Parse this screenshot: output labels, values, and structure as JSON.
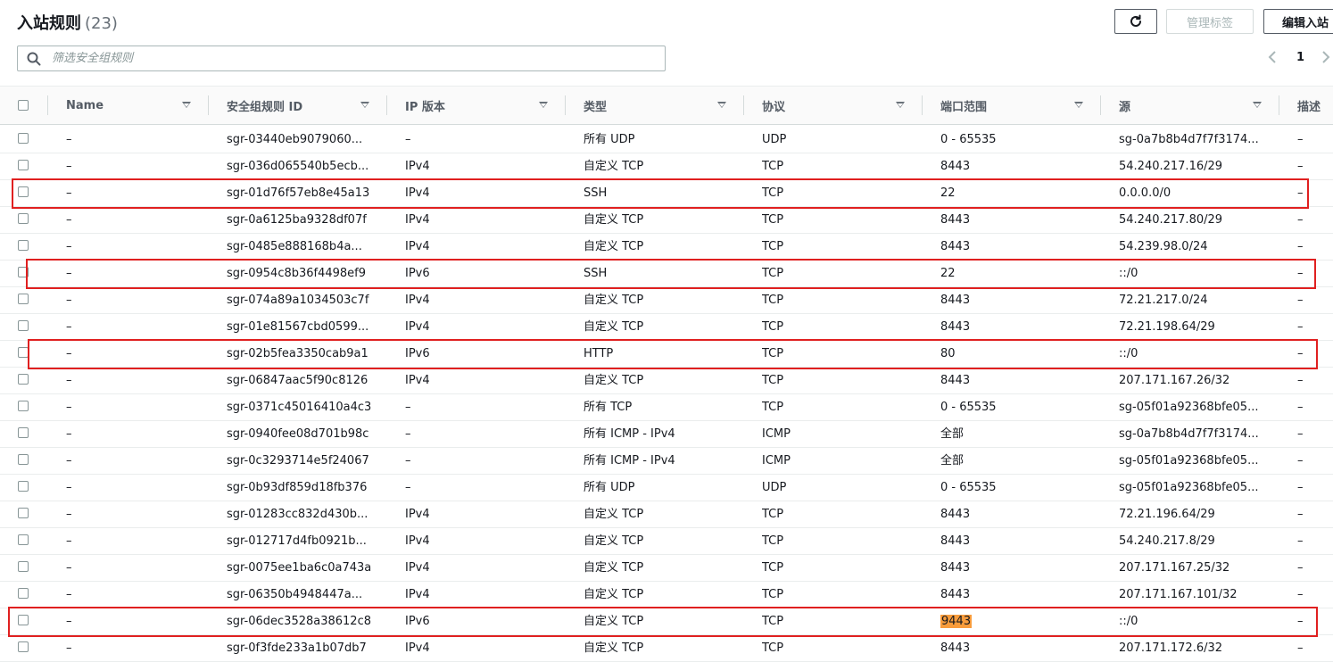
{
  "header": {
    "title": "入站规则",
    "count": "(23)"
  },
  "toolbar": {
    "tags_label": "管理标签",
    "edit_label": "编辑入站"
  },
  "search": {
    "placeholder": "筛选安全组规则"
  },
  "pagination": {
    "prev": "‹",
    "current": "1",
    "next": "›"
  },
  "columns": [
    "Name",
    "安全组规则 ID",
    "IP 版本",
    "类型",
    "协议",
    "端口范围",
    "源",
    "描述"
  ],
  "rows": [
    {
      "name": "–",
      "id": "sgr-03440eb9079060...",
      "ip": "–",
      "type": "所有 UDP",
      "proto": "UDP",
      "port": "0 - 65535",
      "source": "sg-0a7b8b4d7f7f3174...",
      "desc": "–"
    },
    {
      "name": "–",
      "id": "sgr-036d065540b5ecb...",
      "ip": "IPv4",
      "type": "自定义 TCP",
      "proto": "TCP",
      "port": "8443",
      "source": "54.240.217.16/29",
      "desc": "–"
    },
    {
      "name": "–",
      "id": "sgr-01d76f57eb8e45a13",
      "ip": "IPv4",
      "type": "SSH",
      "proto": "TCP",
      "port": "22",
      "source": "0.0.0.0/0",
      "desc": "–"
    },
    {
      "name": "–",
      "id": "sgr-0a6125ba9328df07f",
      "ip": "IPv4",
      "type": "自定义 TCP",
      "proto": "TCP",
      "port": "8443",
      "source": "54.240.217.80/29",
      "desc": "–"
    },
    {
      "name": "–",
      "id": "sgr-0485e888168b4a...",
      "ip": "IPv4",
      "type": "自定义 TCP",
      "proto": "TCP",
      "port": "8443",
      "source": "54.239.98.0/24",
      "desc": "–"
    },
    {
      "name": "–",
      "id": "sgr-0954c8b36f4498ef9",
      "ip": "IPv6",
      "type": "SSH",
      "proto": "TCP",
      "port": "22",
      "source": "::/0",
      "desc": "–"
    },
    {
      "name": "–",
      "id": "sgr-074a89a1034503c7f",
      "ip": "IPv4",
      "type": "自定义 TCP",
      "proto": "TCP",
      "port": "8443",
      "source": "72.21.217.0/24",
      "desc": "–"
    },
    {
      "name": "–",
      "id": "sgr-01e81567cbd0599...",
      "ip": "IPv4",
      "type": "自定义 TCP",
      "proto": "TCP",
      "port": "8443",
      "source": "72.21.198.64/29",
      "desc": "–"
    },
    {
      "name": "–",
      "id": "sgr-02b5fea3350cab9a1",
      "ip": "IPv6",
      "type": "HTTP",
      "proto": "TCP",
      "port": "80",
      "source": "::/0",
      "desc": "–"
    },
    {
      "name": "–",
      "id": "sgr-06847aac5f90c8126",
      "ip": "IPv4",
      "type": "自定义 TCP",
      "proto": "TCP",
      "port": "8443",
      "source": "207.171.167.26/32",
      "desc": "–"
    },
    {
      "name": "–",
      "id": "sgr-0371c45016410a4c3",
      "ip": "–",
      "type": "所有 TCP",
      "proto": "TCP",
      "port": "0 - 65535",
      "source": "sg-05f01a92368bfe05...",
      "desc": "–"
    },
    {
      "name": "–",
      "id": "sgr-0940fee08d701b98c",
      "ip": "–",
      "type": "所有 ICMP - IPv4",
      "proto": "ICMP",
      "port": "全部",
      "source": "sg-0a7b8b4d7f7f3174...",
      "desc": "–"
    },
    {
      "name": "–",
      "id": "sgr-0c3293714e5f24067",
      "ip": "–",
      "type": "所有 ICMP - IPv4",
      "proto": "ICMP",
      "port": "全部",
      "source": "sg-05f01a92368bfe05...",
      "desc": "–"
    },
    {
      "name": "–",
      "id": "sgr-0b93df859d18fb376",
      "ip": "–",
      "type": "所有 UDP",
      "proto": "UDP",
      "port": "0 - 65535",
      "source": "sg-05f01a92368bfe05...",
      "desc": "–"
    },
    {
      "name": "–",
      "id": "sgr-01283cc832d430b...",
      "ip": "IPv4",
      "type": "自定义 TCP",
      "proto": "TCP",
      "port": "8443",
      "source": "72.21.196.64/29",
      "desc": "–"
    },
    {
      "name": "–",
      "id": "sgr-012717d4fb0921b...",
      "ip": "IPv4",
      "type": "自定义 TCP",
      "proto": "TCP",
      "port": "8443",
      "source": "54.240.217.8/29",
      "desc": "–"
    },
    {
      "name": "–",
      "id": "sgr-0075ee1ba6c0a743a",
      "ip": "IPv4",
      "type": "自定义 TCP",
      "proto": "TCP",
      "port": "8443",
      "source": "207.171.167.25/32",
      "desc": "–"
    },
    {
      "name": "–",
      "id": "sgr-06350b4948447a...",
      "ip": "IPv4",
      "type": "自定义 TCP",
      "proto": "TCP",
      "port": "8443",
      "source": "207.171.167.101/32",
      "desc": "–"
    },
    {
      "name": "–",
      "id": "sgr-06dec3528a38612c8",
      "ip": "IPv6",
      "type": "自定义 TCP",
      "proto": "TCP",
      "port": "9443",
      "source": "::/0",
      "desc": "–",
      "port_highlight": true
    },
    {
      "name": "–",
      "id": "sgr-0f3fde233a1b07db7",
      "ip": "IPv4",
      "type": "自定义 TCP",
      "proto": "TCP",
      "port": "8443",
      "source": "207.171.172.6/32",
      "desc": "–"
    }
  ],
  "annotations": {
    "boxed_rows": [
      2,
      5,
      8,
      18
    ],
    "color": "#e02020"
  },
  "colors": {
    "highlight": "#f89c3c",
    "annotation": "#e02020",
    "header_text": "#545b64"
  }
}
